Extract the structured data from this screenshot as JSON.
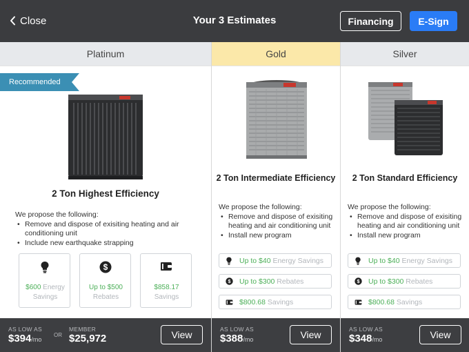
{
  "header": {
    "close_label": "Close",
    "title": "Your 3 Estimates",
    "financing_label": "Financing",
    "esign_label": "E-Sign"
  },
  "colors": {
    "accent_blue": "#2a7cf6",
    "ribbon_teal": "#3b8fb4",
    "gold_header": "#fbe8a9",
    "savings_green": "#4caf58"
  },
  "platinum": {
    "tier": "Platinum",
    "badge": "Recommended",
    "product": "2 Ton Highest Efficiency",
    "propose_intro": "We propose the following:",
    "items": [
      "Remove and dispose of exisiting heating and air conditioning unit",
      "Include new earthquake strapping"
    ],
    "boxes": [
      {
        "icon": "lightbulb-icon",
        "value": "$600",
        "label": "Energy Savings"
      },
      {
        "icon": "dollar-icon",
        "value": "Up to $500",
        "label": "Rebates"
      },
      {
        "icon": "wallet-icon",
        "value": "$858.17",
        "label": "Savings"
      }
    ],
    "low_label": "AS LOW AS",
    "low_price": "$394",
    "per_mo": "/mo",
    "or": "OR",
    "member_label": "MEMBER",
    "member_price": "$25,972",
    "view_label": "View"
  },
  "gold": {
    "tier": "Gold",
    "product": "2 Ton Intermediate Efficiency",
    "propose_intro": "We propose the following:",
    "items": [
      "Remove and dispose of exisiting heating and air conditioning unit",
      "Install new program"
    ],
    "rows": [
      {
        "icon": "lightbulb-icon",
        "value": "Up to $40",
        "label": "Energy Savings"
      },
      {
        "icon": "dollar-icon",
        "value": "Up to $300",
        "label": "Rebates"
      },
      {
        "icon": "wallet-icon",
        "value": "$800.68",
        "label": "Savings"
      }
    ],
    "low_label": "AS LOW AS",
    "low_price": "$388",
    "per_mo": "/mo",
    "view_label": "View"
  },
  "silver": {
    "tier": "Silver",
    "product": "2 Ton Standard Efficiency",
    "propose_intro": "We propose the following:",
    "items": [
      "Remove and dispose of exisiting heating and air conditioning unit",
      "Install new program"
    ],
    "rows": [
      {
        "icon": "lightbulb-icon",
        "value": "Up to $40",
        "label": "Energy Savings"
      },
      {
        "icon": "dollar-icon",
        "value": "Up to $300",
        "label": "Rebates"
      },
      {
        "icon": "wallet-icon",
        "value": "$800.68",
        "label": "Savings"
      }
    ],
    "low_label": "AS LOW AS",
    "low_price": "$348",
    "per_mo": "/mo",
    "view_label": "View"
  }
}
